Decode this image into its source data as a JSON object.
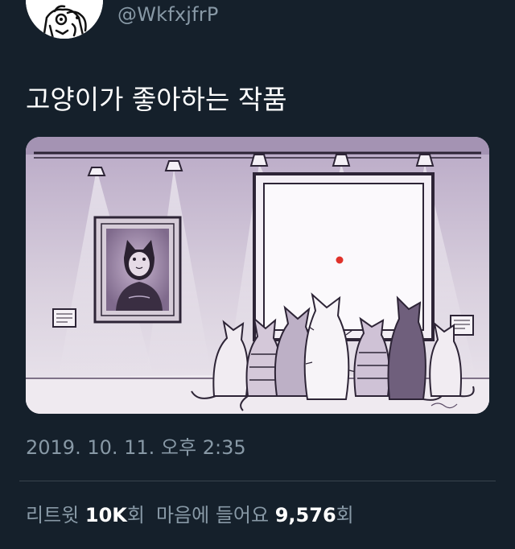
{
  "user": {
    "handle": "@WkfxjfrP"
  },
  "tweet": {
    "text": "고양이가 좋아하는 작품",
    "timestamp": "2019. 10. 11. 오후 2:35"
  },
  "stats": {
    "retweets_label": "리트윗",
    "retweets_count": "10K",
    "retweets_suffix": "회",
    "likes_label": "마음에 들어요",
    "likes_count": "9,576",
    "likes_suffix": "회"
  },
  "colors": {
    "background": "#15202b",
    "secondary_text": "#8899a6",
    "divider": "#38444d",
    "laser_dot": "#e0322a"
  }
}
